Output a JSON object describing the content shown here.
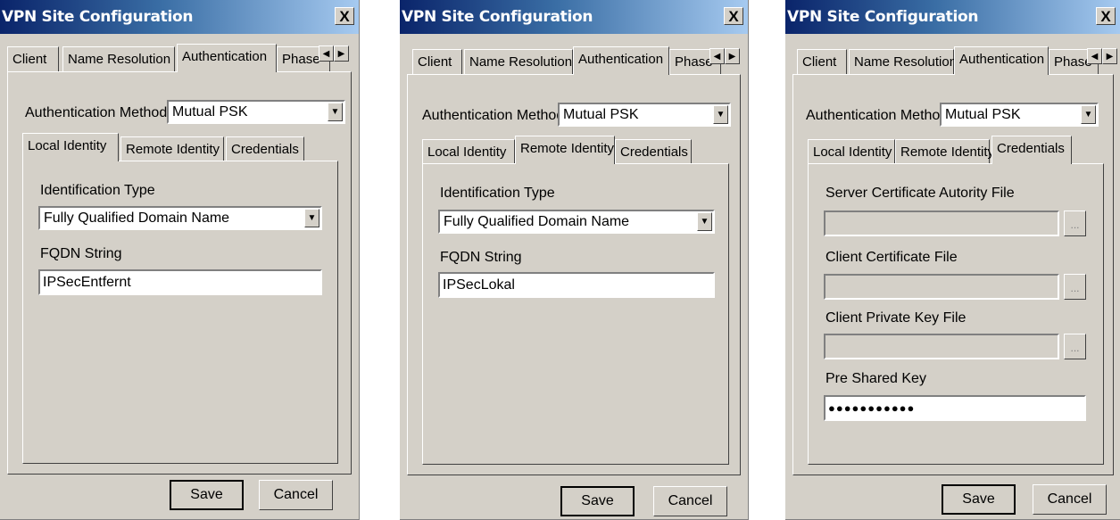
{
  "windows": [
    {
      "title": "VPN Site Configuration",
      "close_label": "X",
      "tabs": [
        "Client",
        "Name Resolution",
        "Authentication",
        "Phase"
      ],
      "active_tab": "Authentication",
      "auth_method_label": "Authentication Method",
      "auth_method_value": "Mutual PSK",
      "inner_tabs": [
        "Local Identity",
        "Remote Identity",
        "Credentials"
      ],
      "active_inner_tab": "Local Identity",
      "identification_type_label": "Identification Type",
      "identification_type_value": "Fully Qualified Domain Name",
      "fqdn_label": "FQDN String",
      "fqdn_value": "IPSecEntfernt",
      "save_label": "Save",
      "cancel_label": "Cancel"
    },
    {
      "title": "VPN Site Configuration",
      "close_label": "X",
      "tabs": [
        "Client",
        "Name Resolution",
        "Authentication",
        "Phase"
      ],
      "active_tab": "Authentication",
      "auth_method_label": "Authentication Method",
      "auth_method_value": "Mutual PSK",
      "inner_tabs": [
        "Local Identity",
        "Remote Identity",
        "Credentials"
      ],
      "active_inner_tab": "Remote Identity",
      "identification_type_label": "Identification Type",
      "identification_type_value": "Fully Qualified Domain Name",
      "fqdn_label": "FQDN String",
      "fqdn_value": "IPSecLokal",
      "save_label": "Save",
      "cancel_label": "Cancel"
    },
    {
      "title": "VPN Site Configuration",
      "close_label": "X",
      "tabs": [
        "Client",
        "Name Resolution",
        "Authentication",
        "Phase"
      ],
      "active_tab": "Authentication",
      "auth_method_label": "Authentication Method",
      "auth_method_value": "Mutual PSK",
      "inner_tabs": [
        "Local Identity",
        "Remote Identity",
        "Credentials"
      ],
      "active_inner_tab": "Credentials",
      "server_ca_label": "Server Certificate Autority File",
      "server_ca_value": "",
      "client_cert_label": "Client Certificate File",
      "client_cert_value": "",
      "client_key_label": "Client Private Key File",
      "client_key_value": "",
      "browse_label": "...",
      "psk_label": "Pre Shared Key",
      "psk_value": "●●●●●●●●●●●",
      "save_label": "Save",
      "cancel_label": "Cancel"
    }
  ],
  "icons": {
    "tab_scroll_left": "◀",
    "tab_scroll_right": "▶",
    "dropdown_arrow": "▼"
  }
}
